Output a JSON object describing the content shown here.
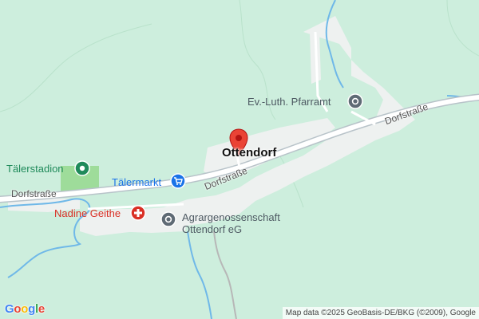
{
  "map": {
    "place_label": "Ottendorf",
    "streets": [
      "Dorfstraße",
      "Dorfstraße",
      "Dorfstraße"
    ],
    "pois": {
      "stadium": "Tälerstadion",
      "market": "Tälermarkt",
      "doctor": "Nadine Geithe",
      "church": "Ev.-Luth. Pfarramt",
      "coop_line1": "Agrargenossenschaft",
      "coop_line2": "Ottendorf eG"
    },
    "colors": {
      "background": "#cdeedd",
      "settlement": "#eef1f0",
      "road": "#ffffff",
      "water": "#6fb8e8",
      "marker": "#ea4335",
      "poi_green": "#1f8a5a",
      "poi_blue": "#1a73e8",
      "poi_red": "#d93025",
      "poi_gray": "#5f6b75"
    },
    "attribution": "Map data ©2025 GeoBasis-DE/BKG (©2009), Google",
    "logo_letters": [
      "G",
      "o",
      "o",
      "g",
      "l",
      "e"
    ]
  }
}
